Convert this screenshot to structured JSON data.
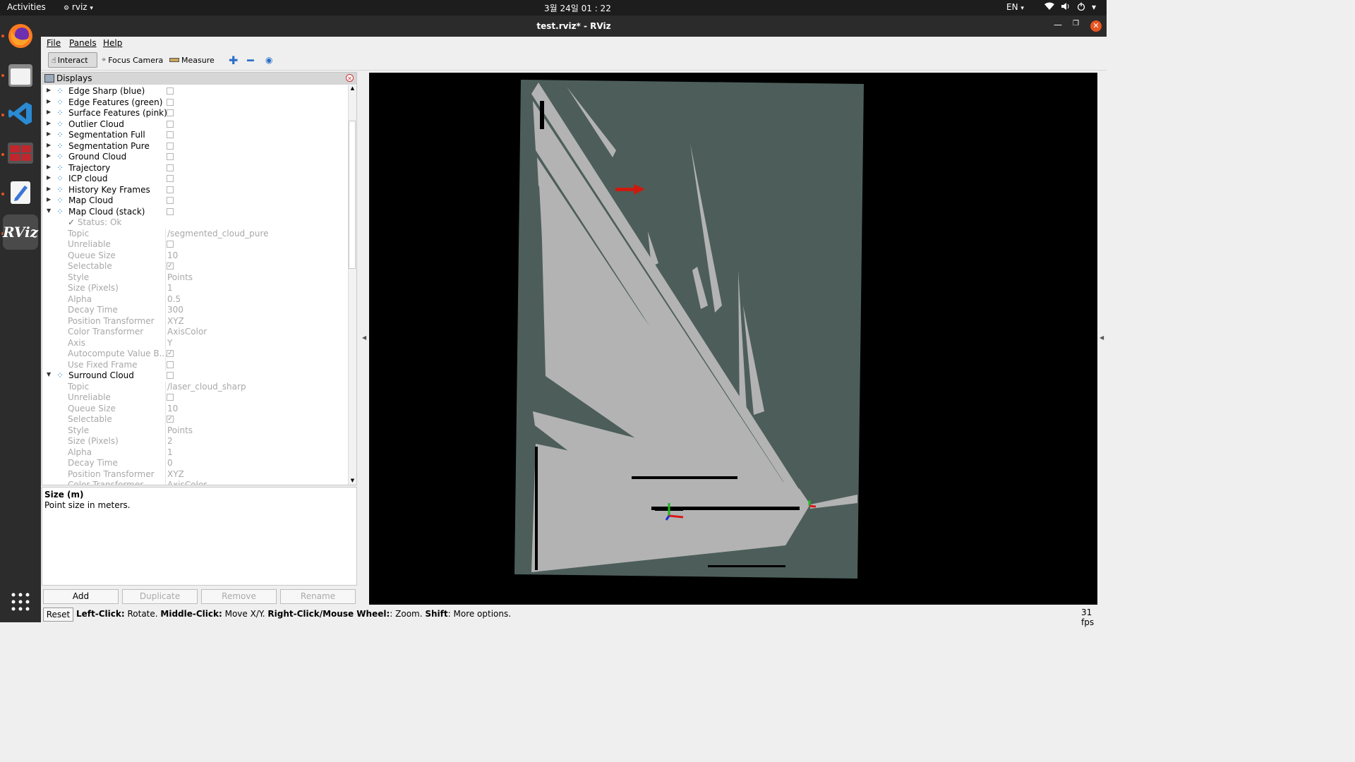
{
  "topbar": {
    "activities": "Activities",
    "app": "rviz",
    "clock": "3월 24일  01 : 22",
    "lang": "EN"
  },
  "window": {
    "title": "test.rviz* - RViz"
  },
  "menu": [
    "File",
    "Panels",
    "Help"
  ],
  "toolbar": {
    "interact": "Interact",
    "focus_camera": "Focus Camera",
    "measure": "Measure"
  },
  "displays": {
    "title": "Displays",
    "items": [
      {
        "label": "Edge Sharp (blue)"
      },
      {
        "label": "Edge Features (green)"
      },
      {
        "label": "Surface Features (pink)"
      },
      {
        "label": "Outlier Cloud"
      },
      {
        "label": "Segmentation Full"
      },
      {
        "label": "Segmentation Pure"
      },
      {
        "label": "Ground Cloud"
      },
      {
        "label": "Trajectory"
      },
      {
        "label": "ICP cloud"
      },
      {
        "label": "History Key Frames"
      },
      {
        "label": "Map Cloud"
      },
      {
        "label": "Map Cloud (stack)"
      }
    ],
    "map_stack_status": "Status: Ok",
    "map_stack_props": [
      {
        "name": "Topic",
        "value": "/segmented_cloud_pure"
      },
      {
        "name": "Unreliable",
        "check": ""
      },
      {
        "name": "Queue Size",
        "value": "10"
      },
      {
        "name": "Selectable",
        "check": "✓"
      },
      {
        "name": "Style",
        "value": "Points"
      },
      {
        "name": "Size (Pixels)",
        "value": "1"
      },
      {
        "name": "Alpha",
        "value": "0.5"
      },
      {
        "name": "Decay Time",
        "value": "300"
      },
      {
        "name": "Position Transformer",
        "value": "XYZ"
      },
      {
        "name": "Color Transformer",
        "value": "AxisColor"
      },
      {
        "name": "Axis",
        "value": "Y"
      },
      {
        "name": "Autocompute Value B...",
        "check": "✓"
      },
      {
        "name": "Use Fixed Frame",
        "check": ""
      }
    ],
    "surround_label": "Surround Cloud",
    "surround_props": [
      {
        "name": "Topic",
        "value": "/laser_cloud_sharp"
      },
      {
        "name": "Unreliable",
        "check": ""
      },
      {
        "name": "Queue Size",
        "value": "10"
      },
      {
        "name": "Selectable",
        "check": "✓"
      },
      {
        "name": "Style",
        "value": "Points"
      },
      {
        "name": "Size (Pixels)",
        "value": "2"
      },
      {
        "name": "Alpha",
        "value": "1"
      },
      {
        "name": "Decay Time",
        "value": "0"
      },
      {
        "name": "Position Transformer",
        "value": "XYZ"
      },
      {
        "name": "Color Transformer",
        "value": "AxisColor"
      }
    ]
  },
  "help": {
    "title": "Size (m)",
    "text": "Point size in meters."
  },
  "buttons": {
    "add": "Add",
    "duplicate": "Duplicate",
    "remove": "Remove",
    "rename": "Rename"
  },
  "status": {
    "reset": "Reset",
    "b1": "Left-Click:",
    "t1": " Rotate. ",
    "b2": "Middle-Click:",
    "t2": " Move X/Y. ",
    "b3": "Right-Click/Mouse Wheel:",
    "t3": ": Zoom. ",
    "b4": "Shift",
    "t4": ": More options.",
    "fps": "31 fps"
  },
  "colors": {
    "map_background": "#4d5e5a",
    "scan_gray": "#b3b3b3",
    "pose_arrow": "#cc1a0f",
    "accent": "#e95420"
  }
}
